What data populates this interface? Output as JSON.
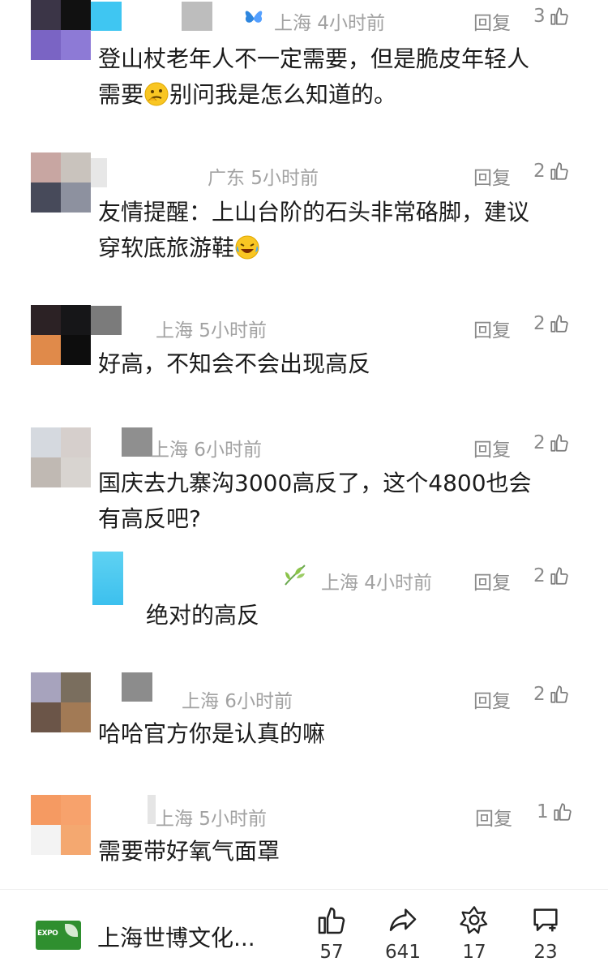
{
  "comments": [
    {
      "meta": "上海 4小时前",
      "reply": "回复",
      "likes": "3",
      "text_line1": "登山杖老年人不一定需要，但是脆皮年轻人",
      "text_line2_a": "需要",
      "emoji": "thinking-face",
      "text_line2_b": "别问我是怎么知道的。",
      "badge_icon": "butterfly-icon"
    },
    {
      "meta": "广东 5小时前",
      "reply": "回复",
      "likes": "2",
      "text_line1": "友情提醒：上山台阶的石头非常硌脚，建议",
      "text_line2_a": "穿软底旅游鞋",
      "emoji": "laughing-crying-face"
    },
    {
      "meta": "上海 5小时前",
      "reply": "回复",
      "likes": "2",
      "text_line1": "好高，不知会不会出现高反"
    },
    {
      "meta": "上海 6小时前",
      "reply": "回复",
      "likes": "2",
      "text_line1": "国庆去九寨沟3000高反了，这个4800也会",
      "text_line2_a": "有高反吧?"
    },
    {
      "meta": "上海 4小时前",
      "reply": "回复",
      "likes": "2",
      "text_line1": "绝对的高反",
      "badge_icon": "leaf-icon",
      "is_reply": true
    },
    {
      "meta": "上海 6小时前",
      "reply": "回复",
      "likes": "2",
      "text_line1": "哈哈官方你是认真的嘛"
    },
    {
      "meta": "上海 5小时前",
      "reply": "回复",
      "likes": "1",
      "text_line1": "需要带好氧气面罩"
    }
  ],
  "bottom_bar": {
    "logo_text": "EXPO",
    "brand_name": "上海世博文化...",
    "like_count": "57",
    "share_count": "641",
    "favorite_count": "17",
    "comment_count": "23"
  },
  "colors": {
    "meta_gray": "#a2a2a2",
    "text": "#1b1b1b",
    "logo_green": "#2f8f2f"
  }
}
